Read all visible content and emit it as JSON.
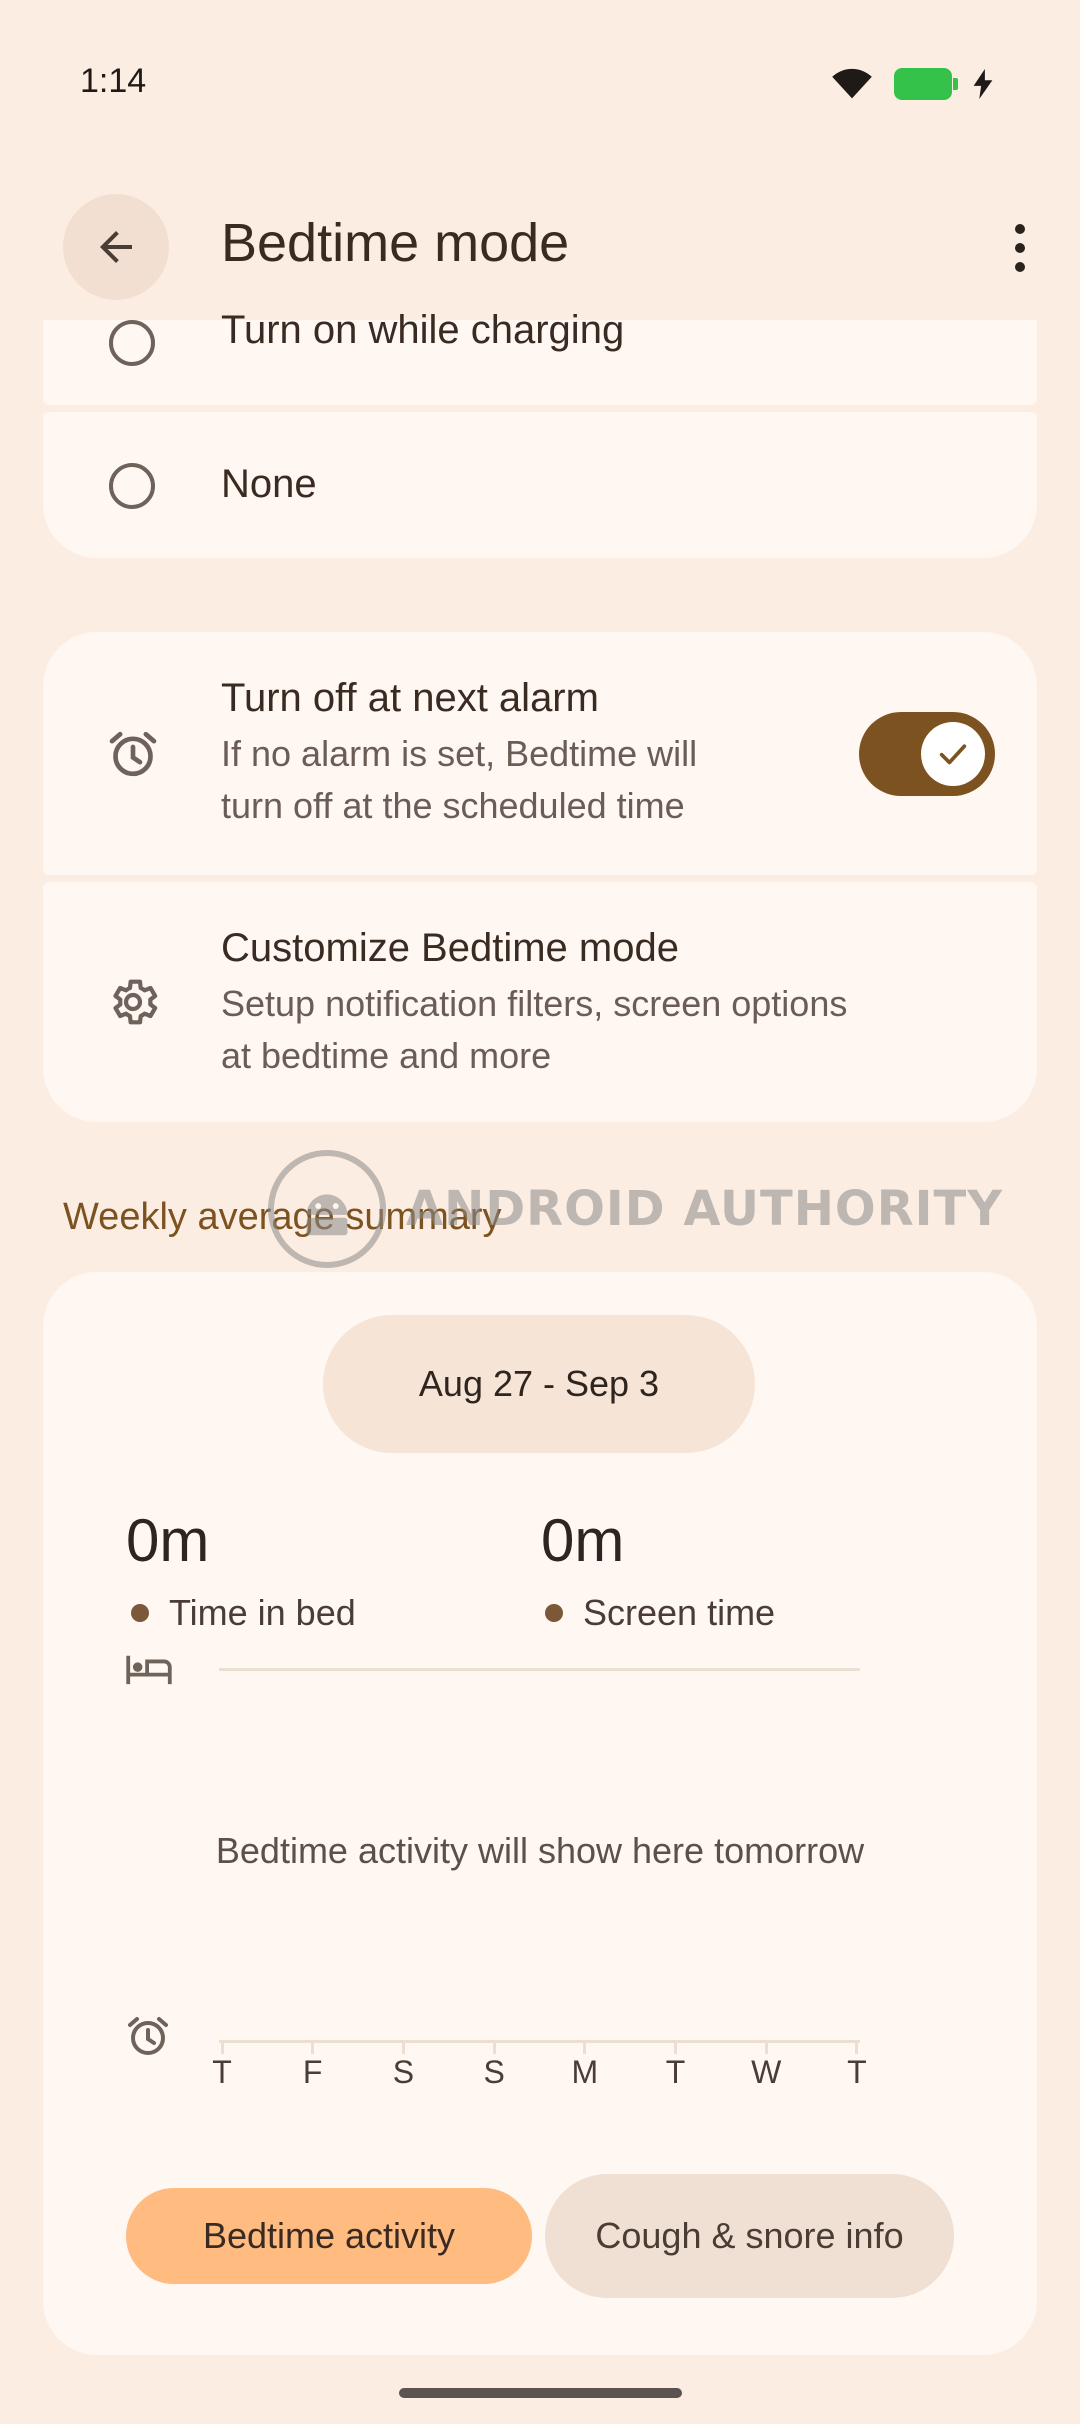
{
  "status_bar": {
    "time": "1:14",
    "icons": [
      "wifi-icon",
      "battery-charging-icon"
    ],
    "battery_color": "#35c24a"
  },
  "header": {
    "title": "Bedtime mode",
    "back_icon": "arrow-back-icon",
    "menu_icon": "more-vert-icon"
  },
  "schedule_options": [
    {
      "label": "Turn on while charging",
      "selected": false
    },
    {
      "label": "None",
      "selected": false
    }
  ],
  "settings": {
    "alarm": {
      "title": "Turn off at next alarm",
      "subtitle_line1": "If no alarm is set, Bedtime will",
      "subtitle_line2": "turn off at the scheduled time",
      "enabled": true,
      "icon": "alarm-icon"
    },
    "customize": {
      "title": "Customize Bedtime mode",
      "subtitle_line1": "Setup notification filters, screen options",
      "subtitle_line2": "at bedtime and more",
      "icon": "gear-icon"
    }
  },
  "weekly": {
    "section_title": "Weekly average summary",
    "date_range": "Aug 27 - Sep 3",
    "time_in_bed": {
      "value": "0m",
      "label": "Time in bed"
    },
    "screen_time": {
      "value": "0m",
      "label": "Screen time"
    },
    "empty_message": "Bedtime activity will show here tomorrow",
    "days": [
      "T",
      "F",
      "S",
      "S",
      "M",
      "T",
      "W",
      "T"
    ]
  },
  "tabs": {
    "active": "Bedtime activity",
    "secondary": "Cough & snore info"
  },
  "watermark": {
    "text": "ANDROID AUTHORITY"
  },
  "colors": {
    "background": "#fcede3",
    "card": "#fff7f2",
    "accent": "#7c5320",
    "active_button": "#ffbb80"
  }
}
